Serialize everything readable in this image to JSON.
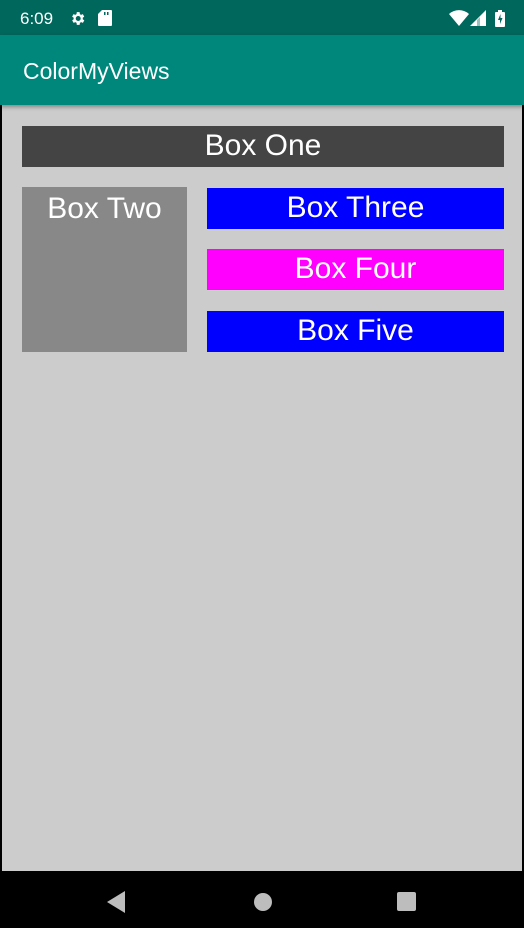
{
  "status_bar": {
    "time": "6:09",
    "icons": [
      "settings-icon",
      "sd-card-icon",
      "wifi-icon",
      "signal-icon",
      "battery-icon"
    ]
  },
  "app_bar": {
    "title": "ColorMyViews"
  },
  "boxes": {
    "one": {
      "label": "Box One",
      "color": "#444444"
    },
    "two": {
      "label": "Box Two",
      "color": "#888888"
    },
    "three": {
      "label": "Box Three",
      "color": "#0000ff"
    },
    "four": {
      "label": "Box Four",
      "color": "#ff00ff"
    },
    "five": {
      "label": "Box Five",
      "color": "#0000ff"
    }
  },
  "background_color": "#cccccc",
  "nav_bar": {
    "buttons": [
      "back-icon",
      "home-icon",
      "recents-icon"
    ]
  }
}
